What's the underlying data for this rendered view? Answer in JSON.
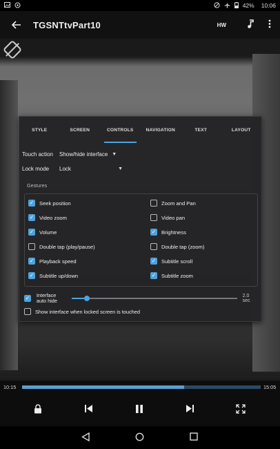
{
  "status_bar": {
    "battery": "42%",
    "time": "10:06",
    "icons": [
      "photo-icon",
      "sync-icon",
      "dnd-icon",
      "airplane-icon",
      "battery-icon"
    ]
  },
  "title_bar": {
    "title": "TGSNTtvPart10",
    "hw_label": "HW",
    "icons": [
      "back-arrow-icon",
      "music-note-icon",
      "more-vert-icon"
    ]
  },
  "dialog": {
    "tabs": [
      {
        "label": "STYLE",
        "active": false
      },
      {
        "label": "SCREEN",
        "active": false
      },
      {
        "label": "CONTROLS",
        "active": true
      },
      {
        "label": "NAVIGATION",
        "active": false
      },
      {
        "label": "TEXT",
        "active": false
      },
      {
        "label": "LAYOUT",
        "active": false
      }
    ],
    "touch_action": {
      "label": "Touch action",
      "value": "Show/hide interface"
    },
    "lock_mode": {
      "label": "Lock mode",
      "value": "Lock"
    },
    "gestures_label": "Gestures",
    "gestures": {
      "seek_position": {
        "label": "Seek position",
        "checked": true
      },
      "zoom_and_pan": {
        "label": "Zoom and Pan",
        "checked": false
      },
      "video_zoom": {
        "label": "Video zoom",
        "checked": true
      },
      "video_pan": {
        "label": "Video pan",
        "checked": false
      },
      "volume": {
        "label": "Volume",
        "checked": true
      },
      "brightness": {
        "label": "Brightness",
        "checked": true
      },
      "double_tap_play": {
        "label": "Double tap (play/pause)",
        "checked": false
      },
      "double_tap_zoom": {
        "label": "Double tap (zoom)",
        "checked": false
      },
      "playback_speed": {
        "label": "Playback speed",
        "checked": true
      },
      "subtitle_scroll": {
        "label": "Subtitle scroll",
        "checked": true
      },
      "subtitle_updown": {
        "label": "Subtitle up/down",
        "checked": true
      },
      "subtitle_zoom": {
        "label": "Subtitle zoom",
        "checked": true
      }
    },
    "interface_auto_hide": {
      "label_line1": "Interface",
      "label_line2": "auto hide",
      "checked": true,
      "value": "2.0 sec",
      "slider_fraction": 0.09
    },
    "show_interface_locked": {
      "label": "Show interface when locked screen is touched",
      "checked": false
    }
  },
  "playback": {
    "current_time": "10:15",
    "total_time": "15:05",
    "progress_fraction": 0.68
  },
  "controls": [
    "lock-icon",
    "previous-icon",
    "pause-icon",
    "next-icon",
    "fullscreen-icon"
  ],
  "navbar": [
    "nav-back-icon",
    "nav-home-icon",
    "nav-recents-icon"
  ],
  "colors": {
    "accent": "#4da3dc",
    "dialog_bg": "#242426",
    "bar_bg": "#0d0d0d"
  }
}
